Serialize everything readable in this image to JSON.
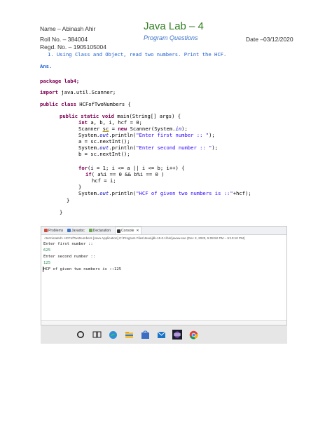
{
  "header": {
    "name": "Name – Abinash Ahir",
    "roll": "Roll No. – 384004",
    "regd": "Regd. No. – 1905105004",
    "title": "Java Lab – 4",
    "subtitle": "Program Questions",
    "date": "Date –03/12/2020"
  },
  "question": "1. Using Class and Object, read two numbers. Print the HCF.",
  "answer_label": "Ans.",
  "code": {
    "l1": "package lab4;",
    "l2a": "import ",
    "l2b": "java.util.Scanner;",
    "l3a": "public class ",
    "l3b": "HCFofTwoNumbers {",
    "l4a": "public static void ",
    "l4b": "main(String[] args) {",
    "l5a": "int ",
    "l5b": "a, b, i, hcf = 0;",
    "l6a": "Scanner ",
    "l6b": "sc",
    "l6c": " = ",
    "l6d": "new ",
    "l6e": "Scanner(System.",
    "l6f": "in",
    "l6g": ");",
    "l7a": "System.",
    "l7b": "out",
    "l7c": ".println(",
    "l7d": "\"Enter first number :: \"",
    "l7e": ");",
    "l8": "a = sc.nextInt();",
    "l9a": "System.",
    "l9b": "out",
    "l9c": ".println(",
    "l9d": "\"Enter second number :: \"",
    "l9e": ");",
    "l10": "b = sc.nextInt();",
    "l11a": "for",
    "l11b": "(i = 1; i <= a || i <= b; i++) {",
    "l12a": "if",
    "l12b": "( a%i == 0 && b%i == 0 )",
    "l13": "hcf = i;",
    "l14": "}",
    "l15a": "System.",
    "l15b": "out",
    "l15c": ".println(",
    "l15d": "\"HCF of given two numbers is ::\"",
    "l15e": "+hcf);",
    "l16": "}",
    "l17": "}"
  },
  "console": {
    "tabs": [
      "Problems",
      "Javadoc",
      "Declaration",
      "Console"
    ],
    "terminated": "<terminated> HCFofTwoNumbers [Java Application] C:\\Program Files\\Java\\jdk-15.0.1\\bin\\javaw.exe (Dec 3, 2020, 5:09:52 PM – 5:10:10 PM)",
    "o1": "Enter first number ::",
    "i1": "625",
    "o2": "Enter second number ::",
    "i2": "125",
    "o3": "HCF of given two numbers is ::125"
  },
  "taskbar": {
    "icons": [
      "cortana-icon",
      "task-view-icon",
      "edge-icon",
      "file-explorer-icon",
      "store-icon",
      "mail-icon",
      "eclipse-icon",
      "chrome-icon"
    ]
  }
}
